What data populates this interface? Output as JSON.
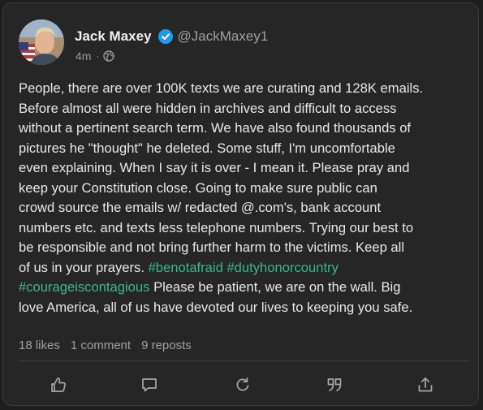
{
  "author": {
    "display_name": "Jack Maxey",
    "handle": "@JackMaxey1",
    "verified": true,
    "avatar": "avatar-photo"
  },
  "meta": {
    "time": "4m",
    "separator": "·",
    "visibility_icon": "globe-icon"
  },
  "post": {
    "text_segments": [
      {
        "text": "People, there are over 100K texts we are curating and 128K emails.\nBefore almost all were hidden in archives and difficult to access\nwithout a pertinent search term. We have also found thousands of\npictures he \"thought\" he deleted. Some stuff, I'm uncomfortable\neven explaining. When I say it is over - I mean it. Please pray and\nkeep your Constitution close. Going to make sure public can\ncrowd source the emails w/ redacted @.com's, bank account\nnumbers etc. and texts less telephone numbers. Trying our best to\nbe responsible and not bring further harm to the victims. Keep all\nof us in your prayers. ",
        "hashtag": false
      },
      {
        "text": "#benotafraid",
        "hashtag": true
      },
      {
        "text": " ",
        "hashtag": false
      },
      {
        "text": "#dutyhonorcountry",
        "hashtag": true
      },
      {
        "text": "\n",
        "hashtag": false
      },
      {
        "text": "#courageiscontagious",
        "hashtag": true
      },
      {
        "text": " Please be patient, we are on the wall. Big\nlove America, all of us have devoted our lives to keeping you safe.",
        "hashtag": false
      }
    ]
  },
  "stats": {
    "likes": "18 likes",
    "comments": "1 comment",
    "reposts": "9 reposts"
  },
  "actions": [
    {
      "name": "like-button",
      "icon": "thumbs-up-icon"
    },
    {
      "name": "comment-button",
      "icon": "comment-icon"
    },
    {
      "name": "repost-button",
      "icon": "repost-icon"
    },
    {
      "name": "quote-button",
      "icon": "quote-icon"
    },
    {
      "name": "share-button",
      "icon": "share-icon"
    }
  ],
  "colors": {
    "background": "#262626",
    "text": "#e8e8e8",
    "hashtag": "#3bb88e",
    "verified": "#1d9bf0",
    "muted": "#a0a0a0"
  }
}
